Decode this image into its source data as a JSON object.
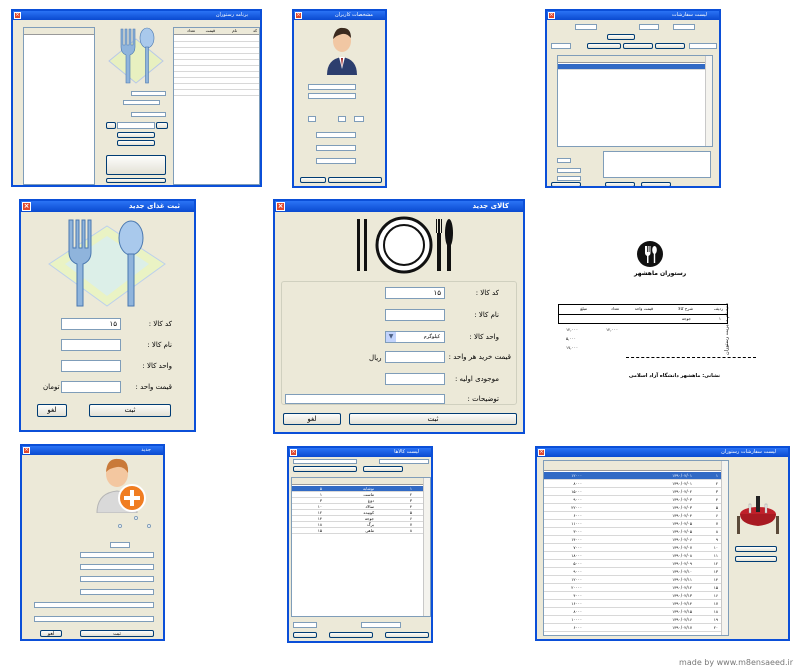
{
  "windows": {
    "main": {
      "title": "برنامه رستوران",
      "grid_headers": [
        "کد",
        "نام",
        "قیمت",
        "تعداد"
      ]
    },
    "customer": {
      "title": "مشخصات کاربران"
    },
    "orders": {
      "title": "لیست سفارشات"
    },
    "new_food": {
      "title": "ثبت غذای جدید",
      "code_label": "کد کالا :",
      "code_value": "۱۵",
      "name_label": "نام کالا :",
      "unit_label": "واحد کالا :",
      "price_label": "قیمت واحد :",
      "price_unit": "تومان",
      "save": "ثبت",
      "cancel": "لغو"
    },
    "new_item": {
      "title": "کالای جدید",
      "code_label": "کد کالا :",
      "code_value": "۱۵",
      "name_label": "نام کالا :",
      "unit_label": "واحد کالا :",
      "unit_value": "کیلوگرم",
      "buy_price_label": "قیمت خرید هر واحد :",
      "currency": "ریال",
      "stock_label": "موجودی اولیه :",
      "notes_label": "توضیحات :",
      "save": "ثبت",
      "cancel": "لغو"
    },
    "receipt": {
      "restaurant": "رستوران ماهشهر",
      "address_line": "نشانی: ماهشهر    دانشگاه آزاد اسلامی",
      "table_headers": [
        "ردیف",
        "شرح کالا",
        "قیمت واحد",
        "تعداد",
        "مبلغ"
      ],
      "row": [
        "۱",
        "جوجه",
        "",
        "",
        ""
      ],
      "totals": [
        "۱۲,۰۰۰",
        "۱۲,۰۰۰",
        "۵,۰۰۰",
        "۱۷,۰۰۰"
      ],
      "side_note": "سیستم مدیریت رستوران"
    },
    "new_customer": {
      "title": "جدید",
      "save": "ثبت",
      "cancel": "لغو"
    },
    "products": {
      "title": "لیست کالاها",
      "rows": [
        [
          "۱",
          "نوشابه",
          "۵"
        ],
        [
          "۲",
          "ماست",
          "۱"
        ],
        [
          "۳",
          "دوغ",
          "۳"
        ],
        [
          "۴",
          "سالاد",
          "۱۰"
        ],
        [
          "۵",
          "کوبیده",
          "۱۲"
        ],
        [
          "۶",
          "جوجه",
          "۱۴"
        ],
        [
          "۷",
          "برگ",
          "۱۸"
        ],
        [
          "۸",
          "ماهی",
          "۱۵"
        ]
      ]
    },
    "order_list": {
      "title": "لیست سفارشات رستوران",
      "rows": [
        [
          "۱",
          "۱۳۹۰/۰۲/۰۱",
          "۱۲۰۰۰"
        ],
        [
          "۲",
          "۱۳۹۰/۰۲/۰۱",
          "۸۰۰۰"
        ],
        [
          "۳",
          "۱۳۹۰/۰۲/۰۲",
          "۱۵۰۰۰"
        ],
        [
          "۴",
          "۱۳۹۰/۰۲/۰۳",
          "۹۰۰۰"
        ],
        [
          "۵",
          "۱۳۹۰/۰۲/۰۳",
          "۲۲۰۰۰"
        ],
        [
          "۶",
          "۱۳۹۰/۰۲/۰۴",
          "۶۰۰۰"
        ],
        [
          "۷",
          "۱۳۹۰/۰۲/۰۵",
          "۱۱۰۰۰"
        ],
        [
          "۸",
          "۱۳۹۰/۰۲/۰۵",
          "۳۰۰۰"
        ],
        [
          "۹",
          "۱۳۹۰/۰۲/۰۶",
          "۱۴۰۰۰"
        ],
        [
          "۱۰",
          "۱۳۹۰/۰۲/۰۷",
          "۷۰۰۰"
        ],
        [
          "۱۱",
          "۱۳۹۰/۰۲/۰۸",
          "۱۸۰۰۰"
        ],
        [
          "۱۲",
          "۱۳۹۰/۰۲/۰۹",
          "۵۰۰۰"
        ],
        [
          "۱۳",
          "۱۳۹۰/۰۲/۱۰",
          "۹۰۰۰"
        ],
        [
          "۱۴",
          "۱۳۹۰/۰۲/۱۱",
          "۱۲۰۰۰"
        ],
        [
          "۱۵",
          "۱۳۹۰/۰۲/۱۲",
          "۲۰۰۰۰"
        ],
        [
          "۱۶",
          "۱۳۹۰/۰۲/۱۳",
          "۴۰۰۰"
        ],
        [
          "۱۷",
          "۱۳۹۰/۰۲/۱۴",
          "۱۶۰۰۰"
        ],
        [
          "۱۸",
          "۱۳۹۰/۰۲/۱۵",
          "۸۰۰۰"
        ],
        [
          "۱۹",
          "۱۳۹۰/۰۲/۱۶",
          "۱۰۰۰۰"
        ],
        [
          "۲۰",
          "۱۳۹۰/۰۲/۱۷",
          "۶۰۰۰"
        ]
      ]
    }
  },
  "watermark": "made by www.m8ensaeed.ir",
  "colors": {
    "titlebar": "#0a4ad0",
    "window_bg": "#ece9d8",
    "selection": "#316ac5"
  },
  "icons": [
    "fork-spoon-icon",
    "plate-cutlery-icon",
    "user-avatar-icon",
    "add-user-icon",
    "restaurant-table-icon",
    "close-icon"
  ]
}
